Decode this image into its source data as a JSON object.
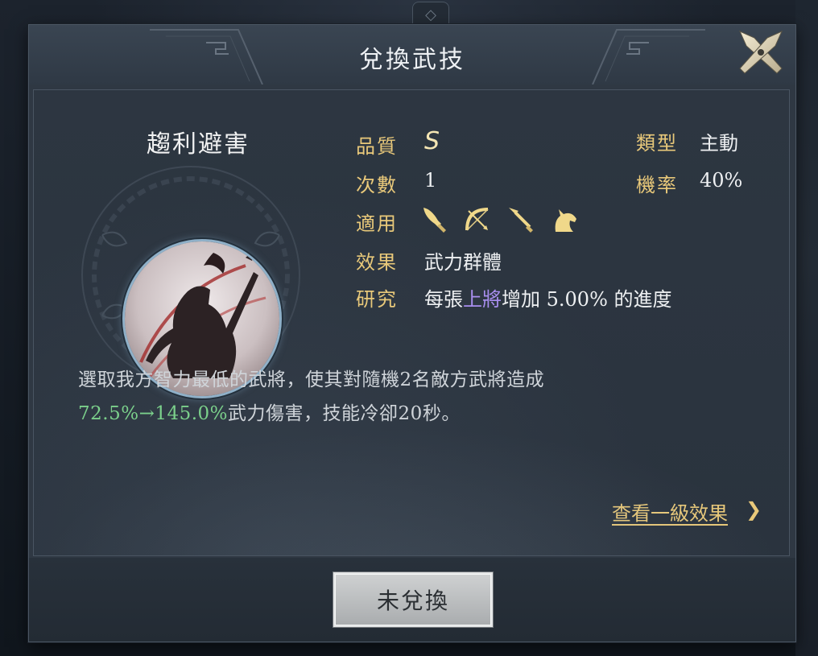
{
  "dialog": {
    "title": "兌換武技",
    "close_icon": "crossed-swords-close-icon"
  },
  "skill": {
    "name": "趨利避害",
    "portrait_icon": "warrior-silhouette-icon",
    "info": {
      "quality_label": "品質",
      "quality_value": "S",
      "type_label": "類型",
      "type_value": "主動",
      "count_label": "次數",
      "count_value": "1",
      "chance_label": "機率",
      "chance_value": "40%",
      "applicable_label": "適用",
      "applicable_icons": [
        "broadsword-icon",
        "bow-icon",
        "spear-icon",
        "horse-icon"
      ],
      "effect_label": "效果",
      "effect_value": "武力群體",
      "research_label": "研究",
      "research_pre": "每張",
      "research_highlight": "上將",
      "research_post": "增加 5.00% 的進度"
    },
    "description": {
      "line1": "選取我方智力最低的武將，使其對隨機2名敵方武將造成",
      "line2_green": "72.5%→145.0%",
      "line2_rest": "武力傷害，技能冷卻20秒。"
    },
    "view_level1_link": "查看一級效果",
    "view_level1_chevron": "❯"
  },
  "footer": {
    "exchange_button": "未兌換"
  },
  "colors": {
    "gold": "#e9c97a",
    "green": "#7bd08b",
    "purple": "#a98ff0",
    "panel": "#2f3843"
  }
}
